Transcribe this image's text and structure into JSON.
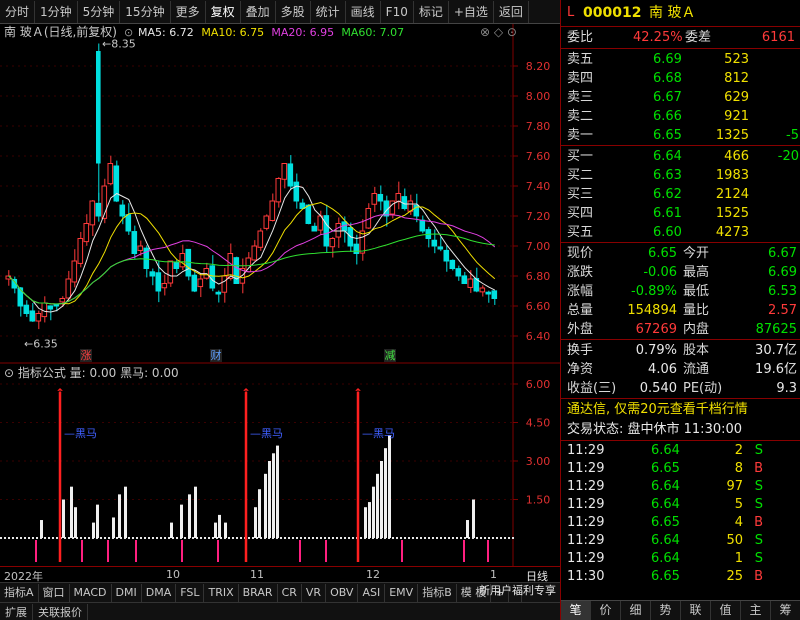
{
  "toolbar": {
    "buttons": [
      "分时",
      "1分钟",
      "5分钟",
      "15分钟",
      "更多",
      "复权",
      "叠加",
      "多股",
      "统计",
      "画线",
      "F10",
      "标记",
      "+自选",
      "返回"
    ],
    "active": "复权"
  },
  "main_chart": {
    "title": "南 玻Ａ(日线,前复权)",
    "ma": [
      {
        "label": "MA5: 6.72",
        "color": "#e8e8e8"
      },
      {
        "label": "MA10: 6.75",
        "color": "#f0e000"
      },
      {
        "label": "MA20: 6.95",
        "color": "#e040e0"
      },
      {
        "label": "MA60: 7.07",
        "color": "#30e030"
      }
    ],
    "y_ticks": [
      "8.20",
      "8.00",
      "7.80",
      "7.60",
      "7.40",
      "7.20",
      "7.00",
      "6.80",
      "6.60",
      "6.40"
    ],
    "high_label": "8.35",
    "low_label": "6.35",
    "events": [
      {
        "label": "涨",
        "color": "#ff4040"
      },
      {
        "label": "财",
        "color": "#60a0ff"
      },
      {
        "label": "减",
        "color": "#40e040"
      }
    ]
  },
  "indicator": {
    "title": "指标公式 量: 0.00 黑马: 0.00",
    "y_ticks": [
      "6.00",
      "4.50",
      "3.00",
      "1.50"
    ],
    "signal_label": "黑马"
  },
  "dates": [
    "2022年",
    "10",
    "11",
    "12",
    "1"
  ],
  "bottom_right_label": "日线",
  "tabs": [
    "指标A",
    "窗口",
    "MACD",
    "DMI",
    "DMA",
    "FSL",
    "TRIX",
    "BRAR",
    "CR",
    "VR",
    "OBV",
    "ASI",
    "EMV",
    "指标B",
    "模 板",
    "+",
    "-"
  ],
  "status_bar": [
    "扩展",
    "关联报价"
  ],
  "quote": {
    "code": "000012",
    "name": "南 玻Ａ",
    "weibi_label": "委比",
    "weibi": "42.25%",
    "weicha_label": "委差",
    "weicha": "6161",
    "sells": [
      {
        "label": "卖五",
        "price": "6.69",
        "vol": "523",
        "chg": ""
      },
      {
        "label": "卖四",
        "price": "6.68",
        "vol": "812",
        "chg": ""
      },
      {
        "label": "卖三",
        "price": "6.67",
        "vol": "629",
        "chg": ""
      },
      {
        "label": "卖二",
        "price": "6.66",
        "vol": "921",
        "chg": ""
      },
      {
        "label": "卖一",
        "price": "6.65",
        "vol": "1325",
        "chg": "-5"
      }
    ],
    "buys": [
      {
        "label": "买一",
        "price": "6.64",
        "vol": "466",
        "chg": "-20"
      },
      {
        "label": "买二",
        "price": "6.63",
        "vol": "1983",
        "chg": ""
      },
      {
        "label": "买三",
        "price": "6.62",
        "vol": "2124",
        "chg": ""
      },
      {
        "label": "买四",
        "price": "6.61",
        "vol": "1525",
        "chg": ""
      },
      {
        "label": "买五",
        "price": "6.60",
        "vol": "4273",
        "chg": ""
      }
    ],
    "stats": [
      {
        "l1": "现价",
        "v1": "6.65",
        "c1": "green",
        "l2": "今开",
        "v2": "6.67",
        "c2": "green"
      },
      {
        "l1": "涨跌",
        "v1": "-0.06",
        "c1": "green",
        "l2": "最高",
        "v2": "6.69",
        "c2": "green"
      },
      {
        "l1": "涨幅",
        "v1": "-0.89%",
        "c1": "green",
        "l2": "最低",
        "v2": "6.53",
        "c2": "green"
      },
      {
        "l1": "总量",
        "v1": "154894",
        "c1": "yellow",
        "l2": "量比",
        "v2": "2.57",
        "c2": "red"
      },
      {
        "l1": "外盘",
        "v1": "67269",
        "c1": "red",
        "l2": "内盘",
        "v2": "87625",
        "c2": "green"
      }
    ],
    "fund": [
      {
        "l1": "换手",
        "v1": "0.79%",
        "l2": "股本",
        "v2": "30.7亿"
      },
      {
        "l1": "净资",
        "v1": "4.06",
        "l2": "流通",
        "v2": "19.6亿"
      },
      {
        "l1": "收益(三)",
        "v1": "0.540",
        "l2": "PE(动)",
        "v2": "9.3"
      }
    ],
    "promo": "通达信, 仅需20元查看千档行情",
    "trade_state": "交易状态: 盘中休市 11:30:00",
    "ticks": [
      {
        "time": "11:29",
        "price": "6.64",
        "vol": "2",
        "side": "S"
      },
      {
        "time": "11:29",
        "price": "6.65",
        "vol": "8",
        "side": "B"
      },
      {
        "time": "11:29",
        "price": "6.64",
        "vol": "97",
        "side": "S"
      },
      {
        "time": "11:29",
        "price": "6.64",
        "vol": "5",
        "side": "S"
      },
      {
        "time": "11:29",
        "price": "6.65",
        "vol": "4",
        "side": "B"
      },
      {
        "time": "11:29",
        "price": "6.64",
        "vol": "50",
        "side": "S"
      },
      {
        "time": "11:29",
        "price": "6.64",
        "vol": "1",
        "side": "S"
      },
      {
        "time": "11:30",
        "price": "6.65",
        "vol": "25",
        "side": "B"
      }
    ],
    "promo2": "新用户福利专享",
    "bottom_tabs": [
      "笔",
      "价",
      "细",
      "势",
      "联",
      "值",
      "主",
      "筹"
    ]
  },
  "colors": {
    "up": "#ff3a3a",
    "down": "#00e0e0",
    "accent": "#800000"
  }
}
